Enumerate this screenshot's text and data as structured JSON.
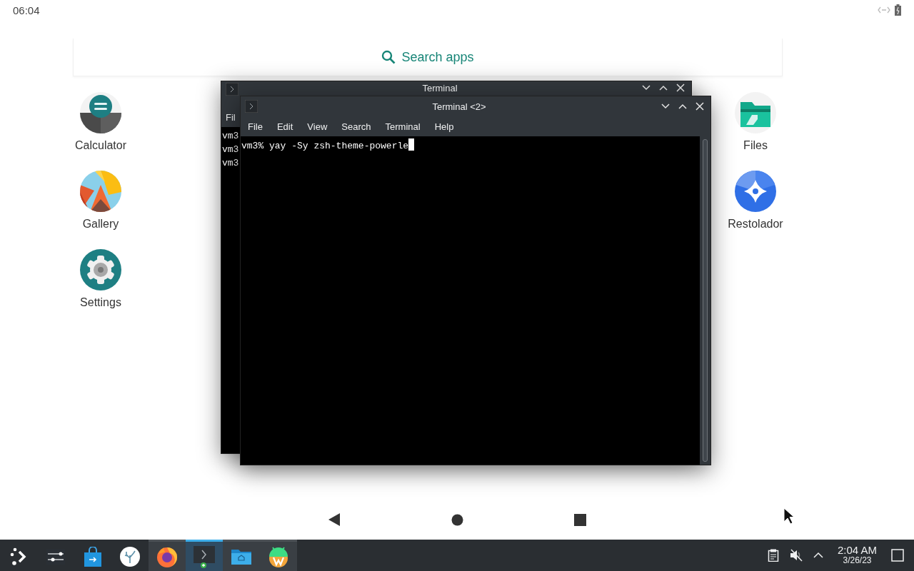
{
  "status_bar": {
    "time": "06:04"
  },
  "search": {
    "placeholder": "Search apps"
  },
  "apps_left": [
    {
      "kind": "calculator",
      "label": "Calculator"
    },
    {
      "kind": "gallery",
      "label": "Gallery"
    },
    {
      "kind": "settings",
      "label": "Settings"
    }
  ],
  "apps_right": [
    {
      "kind": "files",
      "label": "Files"
    },
    {
      "kind": "restolador",
      "label": "Restolador"
    }
  ],
  "windows": [
    {
      "title": "Terminal",
      "menu": [
        "Fil"
      ],
      "lines": [
        "vm3",
        "vm3",
        "vm3"
      ],
      "focused": false
    },
    {
      "title": "Terminal <2>",
      "menu": [
        "File",
        "Edit",
        "View",
        "Search",
        "Terminal",
        "Help"
      ],
      "lines": [
        "vm3% yay -Sy zsh-theme-powerle"
      ],
      "focused": true
    }
  ],
  "taskbar": {
    "items": [
      {
        "kind": "launcher",
        "running": false,
        "selected": false
      },
      {
        "kind": "sliders",
        "running": false,
        "selected": false
      },
      {
        "kind": "store",
        "running": false,
        "selected": false
      },
      {
        "kind": "coral",
        "running": false,
        "selected": false
      },
      {
        "kind": "firefox",
        "running": true,
        "selected": false
      },
      {
        "kind": "terminal",
        "running": true,
        "selected": true
      },
      {
        "kind": "folder",
        "running": true,
        "selected": false
      },
      {
        "kind": "android",
        "running": true,
        "selected": false
      }
    ],
    "clock": {
      "time": "2:04 AM",
      "date": "3/26/23"
    }
  }
}
